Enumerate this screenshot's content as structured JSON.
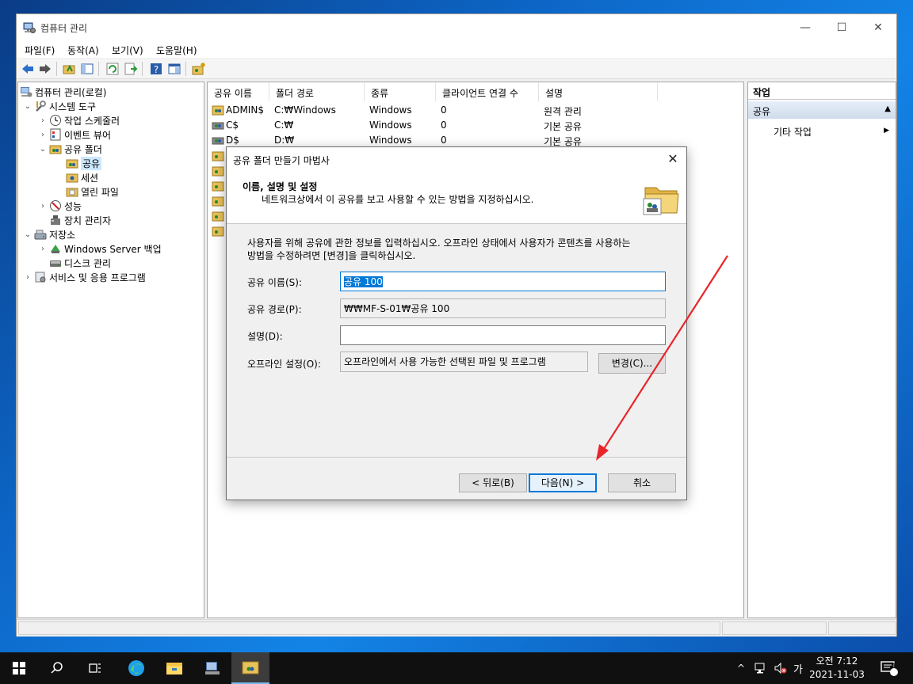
{
  "window": {
    "title": "컴퓨터 관리",
    "controls": {
      "minimize": "—",
      "maximize": "☐",
      "close": "✕"
    }
  },
  "menu": [
    "파일(F)",
    "동작(A)",
    "보기(V)",
    "도움말(H)"
  ],
  "tree": {
    "root": "컴퓨터 관리(로컬)",
    "system_tools": "시스템 도구",
    "task_scheduler": "작업 스케줄러",
    "event_viewer": "이벤트 뷰어",
    "shared_folders": "공유 폴더",
    "shares": "공유",
    "sessions": "세션",
    "open_files": "열린 파일",
    "performance": "성능",
    "device_manager": "장치 관리자",
    "storage": "저장소",
    "windows_server_backup": "Windows Server 백업",
    "disk_management": "디스크 관리",
    "services_apps": "서비스 및 응용 프로그램"
  },
  "share_list": {
    "columns": [
      "공유 이름",
      "폴더 경로",
      "종류",
      "클라이언트 연결 수",
      "설명"
    ],
    "rows": [
      {
        "name": "ADMIN$",
        "path": "C:₩Windows",
        "type": "Windows",
        "clients": "0",
        "desc": "원격 관리"
      },
      {
        "name": "C$",
        "path": "C:₩",
        "type": "Windows",
        "clients": "0",
        "desc": "기본 공유"
      },
      {
        "name": "D$",
        "path": "D:₩",
        "type": "Windows",
        "clients": "0",
        "desc": "기본 공유"
      }
    ]
  },
  "actions": {
    "header": "작업",
    "section": "공유",
    "section_arrow": "▲",
    "more": "기타 작업",
    "more_arrow": "▶"
  },
  "dialog": {
    "title": "공유 폴더 만들기 마법사",
    "heading": "이름, 설명 및 설정",
    "subheading": "네트워크상에서 이 공유를 보고 사용할 수 있는 방법을 지정하십시오.",
    "description_line1": "사용자를 위해 공유에 관한 정보를 입력하십시오. 오프라인 상태에서 사용자가 콘텐츠를 사용하는",
    "description_line2": "방법을 수정하려면 [변경]을 클릭하십시오.",
    "share_name_label": "공유 이름(S):",
    "share_name_value": "공유 100",
    "share_path_label": "공유 경로(P):",
    "share_path_value": "₩₩MF-S-01₩공유 100",
    "description_label": "설명(D):",
    "description_value": "",
    "offline_label": "오프라인 설정(O):",
    "offline_value": "오프라인에서 사용 가능한 선택된 파일 및 프로그램",
    "change_button": "변경(C)...",
    "back_button": "< 뒤로(B)",
    "next_button": "다음(N) >",
    "cancel_button": "취소"
  },
  "taskbar": {
    "tray_up": "^",
    "ime": "가",
    "time": "오전 7:12",
    "date": "2021-11-03",
    "notifications": "1"
  },
  "colors": {
    "accent": "#0078d7",
    "annotation_arrow": "#e8252a"
  }
}
